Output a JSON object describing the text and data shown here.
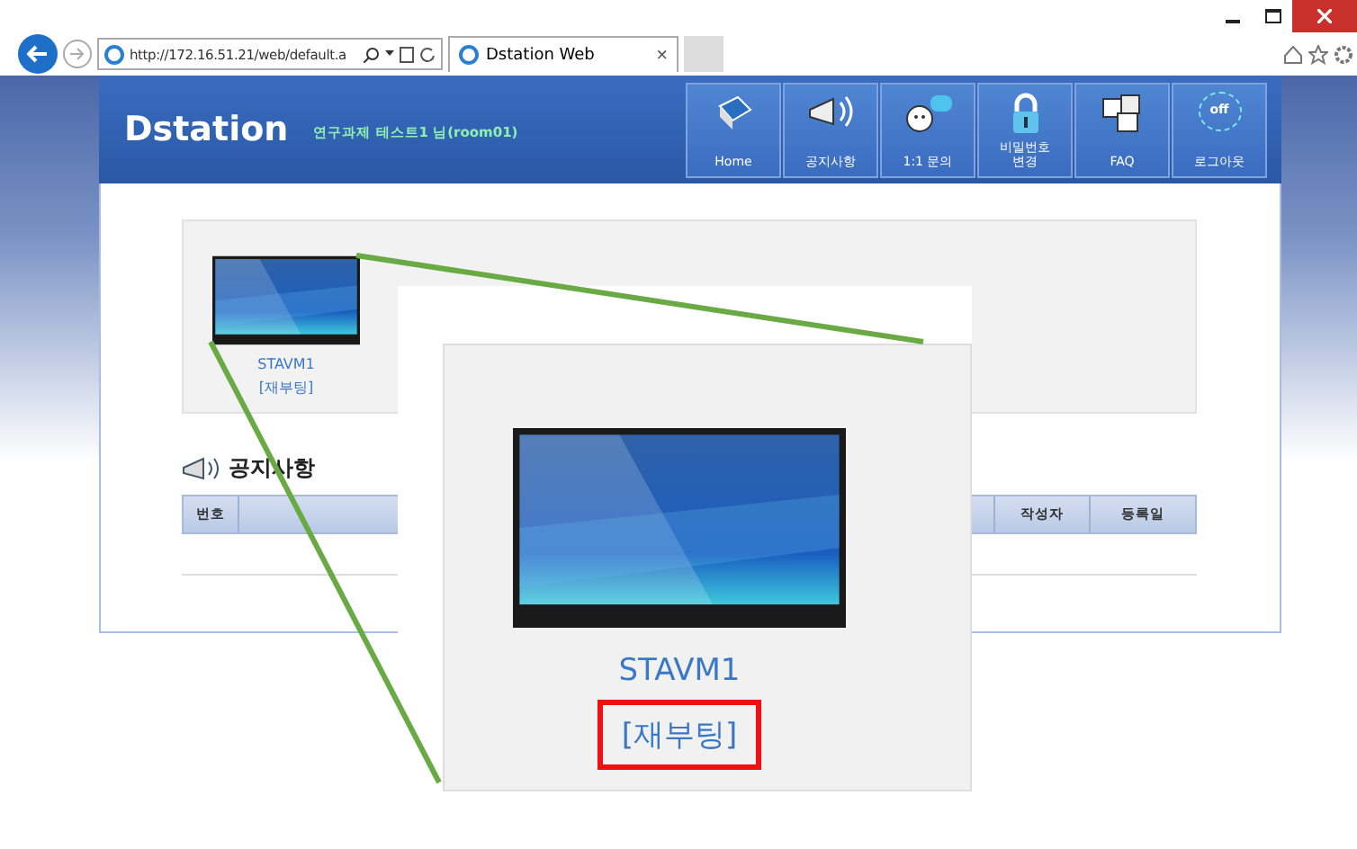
{
  "browser": {
    "address": "http://172.16.51.21/web/default.a",
    "tab_title": "Dstation Web",
    "tab_close": "×"
  },
  "site": {
    "logo": "Dstation",
    "user": "연구과제 테스트1 님(room01)"
  },
  "nav": [
    {
      "label": "Home",
      "kind": "home"
    },
    {
      "label": "공지사항",
      "kind": "notice"
    },
    {
      "label": "1:1 문의",
      "kind": "chat"
    },
    {
      "label": "비밀번호\n변경",
      "kind": "lock"
    },
    {
      "label": "FAQ",
      "kind": "faq"
    },
    {
      "label": "로그아웃",
      "kind": "logout",
      "icon_text": "off"
    }
  ],
  "vms": [
    {
      "name": "STAVM1",
      "action": "[재부팅]"
    }
  ],
  "notices": {
    "title": "공지사항",
    "columns": [
      "번호",
      "작성자",
      "등록일"
    ]
  },
  "callout": {
    "name": "STAVM1",
    "action": "[재부팅]",
    "highlighted": true
  }
}
